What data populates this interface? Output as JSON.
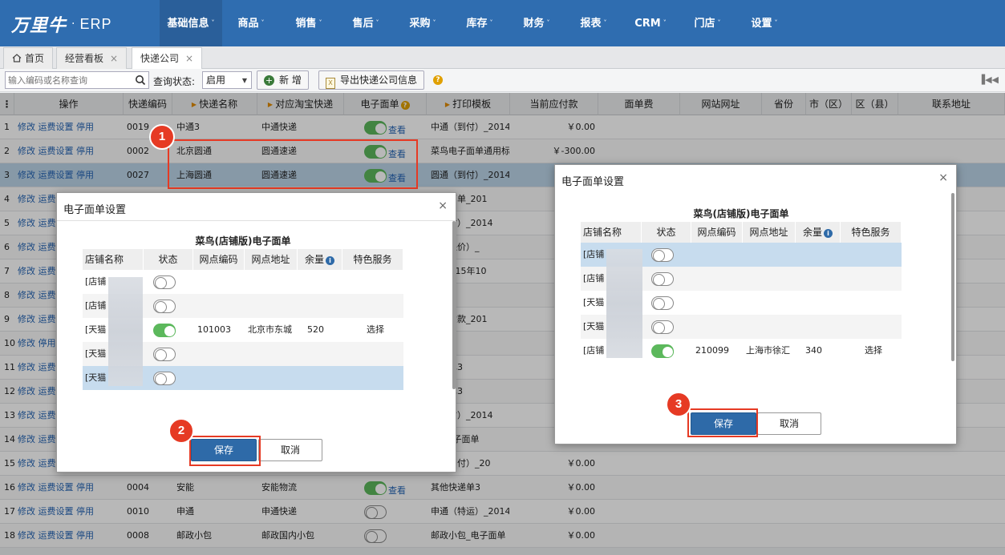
{
  "app": {
    "logo_text": "万里牛",
    "logo_dot": "·",
    "logo_suffix": "ERP"
  },
  "nav": [
    {
      "label": "基础信息",
      "active": true
    },
    {
      "label": "商品"
    },
    {
      "label": "销售"
    },
    {
      "label": "售后"
    },
    {
      "label": "采购"
    },
    {
      "label": "库存"
    },
    {
      "label": "财务"
    },
    {
      "label": "报表"
    },
    {
      "label": "CRM"
    },
    {
      "label": "门店"
    },
    {
      "label": "设置"
    }
  ],
  "tabs": [
    {
      "label": "首页"
    },
    {
      "label": "经营看板",
      "closable": true
    },
    {
      "label": "快递公司",
      "closable": true,
      "active": true
    }
  ],
  "toolbar": {
    "search_placeholder": "输入编码或名称查询",
    "status_label": "查询状态:",
    "status_value": "启用",
    "add_label": "新 增",
    "export_label": "导出快递公司信息"
  },
  "table": {
    "headers": [
      "操作",
      "快递编码",
      "快递名称",
      "对应淘宝快递",
      "电子面单",
      "打印模板",
      "当前应付款",
      "面单费",
      "网站网址",
      "省份",
      "市（区）",
      "区（县）",
      "联系地址"
    ],
    "ops": {
      "edit": "修改",
      "freight": "运费设置",
      "disable": "停用",
      "enable": "启用"
    },
    "check_label": "查看",
    "rows": [
      {
        "n": "1",
        "code": "0019",
        "name": "中通3",
        "tb": "中通快递",
        "ef": true,
        "tpl": "中通（到付）_2014",
        "pay": "￥0.00"
      },
      {
        "n": "2",
        "code": "0002",
        "name": "北京圆通",
        "tb": "圆通速递",
        "ef": true,
        "tpl": "菜鸟电子面单通用标",
        "pay": "￥-300.00"
      },
      {
        "n": "3",
        "code": "0027",
        "name": "上海圆通",
        "tb": "圆通速递",
        "ef": true,
        "tpl": "圆通（到付）_2014",
        "pay": ""
      },
      {
        "n": "4",
        "code": "",
        "name": "",
        "tb": "",
        "ef": null,
        "tpl": "电子面单_201",
        "pay": ""
      },
      {
        "n": "5",
        "code": "",
        "name": "",
        "tb": "",
        "ef": null,
        "tpl": "（到付）_2014",
        "pay": ""
      },
      {
        "n": "6",
        "code": "",
        "name": "",
        "tb": "",
        "ef": null,
        "tpl": "通（保价）_",
        "pay": ""
      },
      {
        "n": "7",
        "code": "",
        "name": "",
        "tb": "",
        "ef": null,
        "tpl": "递_2015年10",
        "pay": ""
      },
      {
        "n": "8",
        "code": "",
        "name": "",
        "tb": "",
        "ef": null,
        "tpl": "copy",
        "pay": ""
      },
      {
        "n": "9",
        "code": "",
        "name": "",
        "tb": "",
        "ef": null,
        "tpl": "代收货款_201",
        "pay": ""
      },
      {
        "n": "10",
        "code": "",
        "name": "",
        "tb": "",
        "ef": null,
        "tpl": "",
        "pay": ""
      },
      {
        "n": "11",
        "code": "",
        "name": "",
        "tb": "",
        "ef": null,
        "tpl": "快递单3",
        "pay": ""
      },
      {
        "n": "12",
        "code": "",
        "name": "",
        "tb": "",
        "ef": null,
        "tpl": "快递单3",
        "pay": ""
      },
      {
        "n": "13",
        "code": "",
        "name": "",
        "tb": "",
        "ef": null,
        "tpl": "（到付）_2014",
        "pay": ""
      },
      {
        "n": "14",
        "code": "",
        "name": "",
        "tb": "",
        "ef": null,
        "tpl": "递_电子面单",
        "pay": ""
      },
      {
        "n": "15",
        "code": "",
        "name": "",
        "tb": "",
        "ef": null,
        "tpl": "丰（到付）_20",
        "pay": "￥0.00"
      },
      {
        "n": "16",
        "code": "0004",
        "name": "安能",
        "tb": "安能物流",
        "ef": true,
        "tpl": "其他快递单3",
        "pay": "￥0.00"
      },
      {
        "n": "17",
        "code": "0010",
        "name": "申通",
        "tb": "申通快递",
        "ef": false,
        "tpl": "申通（特运）_2014",
        "pay": "￥0.00"
      },
      {
        "n": "18",
        "code": "0008",
        "name": "邮政小包",
        "tb": "邮政国内小包",
        "ef": false,
        "tpl": "邮政小包_电子面单",
        "pay": "￥0.00"
      }
    ]
  },
  "modal_left": {
    "title": "电子面单设置",
    "close": "×",
    "subtitle": "菜鸟(店铺版)电子面单",
    "headers": [
      "店铺名称",
      "状态",
      "网点编码",
      "网点地址",
      "余量",
      "特色服务"
    ],
    "rows": [
      {
        "shop": "[店铺",
        "on": false,
        "code": "",
        "addr": "",
        "qty": "",
        "svc": ""
      },
      {
        "shop": "[店铺",
        "on": false,
        "code": "",
        "addr": "",
        "qty": "",
        "svc": ""
      },
      {
        "shop": "[天猫",
        "on": true,
        "code": "101003",
        "addr": "北京市东城",
        "qty": "520",
        "svc": "选择"
      },
      {
        "shop": "[天猫",
        "on": false,
        "code": "",
        "addr": "",
        "qty": "",
        "svc": ""
      },
      {
        "shop": "[天猫",
        "on": false,
        "code": "",
        "addr": "",
        "qty": "",
        "svc": ""
      }
    ],
    "save": "保存",
    "cancel": "取消"
  },
  "modal_right": {
    "title": "电子面单设置",
    "close": "×",
    "subtitle": "菜鸟(店铺版)电子面单",
    "headers": [
      "店铺名称",
      "状态",
      "网点编码",
      "网点地址",
      "余量",
      "特色服务"
    ],
    "rows": [
      {
        "shop": "[店铺",
        "on": false,
        "code": "",
        "addr": "",
        "qty": "",
        "svc": ""
      },
      {
        "shop": "[店铺",
        "on": false,
        "code": "",
        "addr": "",
        "qty": "",
        "svc": ""
      },
      {
        "shop": "[天猫",
        "on": false,
        "code": "",
        "addr": "",
        "qty": "",
        "svc": ""
      },
      {
        "shop": "[天猫",
        "on": false,
        "code": "",
        "addr": "",
        "qty": "",
        "svc": ""
      },
      {
        "shop": "[店铺",
        "on": true,
        "code": "210099",
        "addr": "上海市徐汇",
        "qty": "340",
        "svc": "选择"
      }
    ],
    "save": "保存",
    "cancel": "取消"
  },
  "annotations": {
    "b1": "1",
    "b2": "2",
    "b3": "3"
  },
  "colors": {
    "nav_bg": "#2f6db0",
    "accent": "#2e6aa8",
    "annotation": "#e63a24",
    "toggle_on": "#5cb85c"
  }
}
